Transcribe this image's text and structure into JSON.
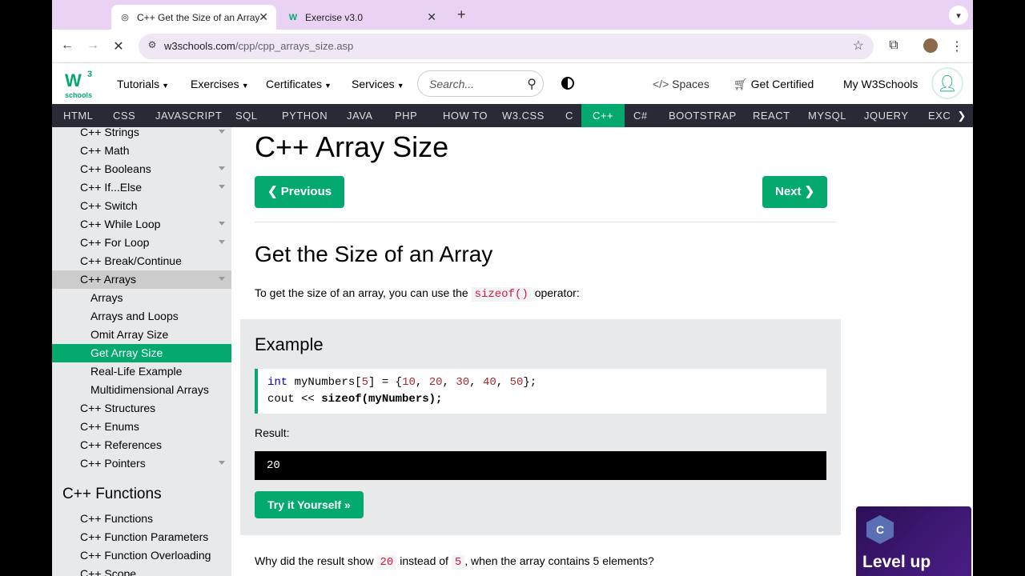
{
  "browser": {
    "tabs": [
      {
        "title": "C++ Get the Size of an Array",
        "favicon": "globe-icon"
      },
      {
        "title": "Exercise v3.0",
        "favicon": "w3-favicon"
      }
    ],
    "new_tab": "+",
    "url_host": "w3schools.com",
    "url_path": "/cpp/cpp_arrays_size.asp"
  },
  "header": {
    "logo_main": "W",
    "logo_sup": "3",
    "logo_sub": "schools",
    "nav": [
      "Tutorials",
      "Exercises",
      "Certificates",
      "Services"
    ],
    "search_placeholder": "Search...",
    "spaces": "Spaces",
    "get_certified": "Get Certified",
    "my_w3": "My W3Schools"
  },
  "topnav": [
    "HTML",
    "CSS",
    "JAVASCRIPT",
    "SQL",
    "PYTHON",
    "JAVA",
    "PHP",
    "HOW TO",
    "W3.CSS",
    "C",
    "C++",
    "C#",
    "BOOTSTRAP",
    "REACT",
    "MYSQL",
    "JQUERY",
    "EXCE"
  ],
  "topnav_active": "C++",
  "sidebar": {
    "items": [
      "C++ Strings",
      "C++ Math",
      "C++ Booleans",
      "C++ If...Else",
      "C++ Switch",
      "C++ While Loop",
      "C++ For Loop",
      "C++ Break/Continue",
      "C++ Arrays",
      "Arrays",
      "Arrays and Loops",
      "Omit Array Size",
      "Get Array Size",
      "Real-Life Example",
      "Multidimensional Arrays",
      "C++ Structures",
      "C++ Enums",
      "C++ References",
      "C++ Pointers"
    ],
    "section_heading": "C++ Functions",
    "functions": [
      "C++ Functions",
      "C++ Function Parameters",
      "C++ Function Overloading",
      "C++ Scope"
    ]
  },
  "main": {
    "title": "C++ Array Size",
    "prev": "❮ Previous",
    "next": "Next ❯",
    "heading": "Get the Size of an Array",
    "intro_a": "To get the size of an array, you can use the",
    "intro_code": "sizeof()",
    "intro_b": "operator:",
    "example_heading": "Example",
    "code": {
      "l1_kw": "int",
      "l1_a": " myNumbers[",
      "l1_n5": "5",
      "l1_b": "] = {",
      "n1": "10",
      "n2": "20",
      "n3": "30",
      "n4": "40",
      "n5": "50",
      "l1_c": "};",
      "l2_a": "cout << ",
      "l2_b": "sizeof(myNumbers);"
    },
    "result_label": "Result:",
    "output": "20",
    "try_it": "Try it Yourself »",
    "bottom_a": "Why did the result show",
    "bottom_c1": "20",
    "bottom_b": "instead of",
    "bottom_c2": "5",
    "bottom_c": ", when the array contains 5 elements?"
  },
  "ad": {
    "text": "Level up",
    "icon_letter": "C"
  }
}
